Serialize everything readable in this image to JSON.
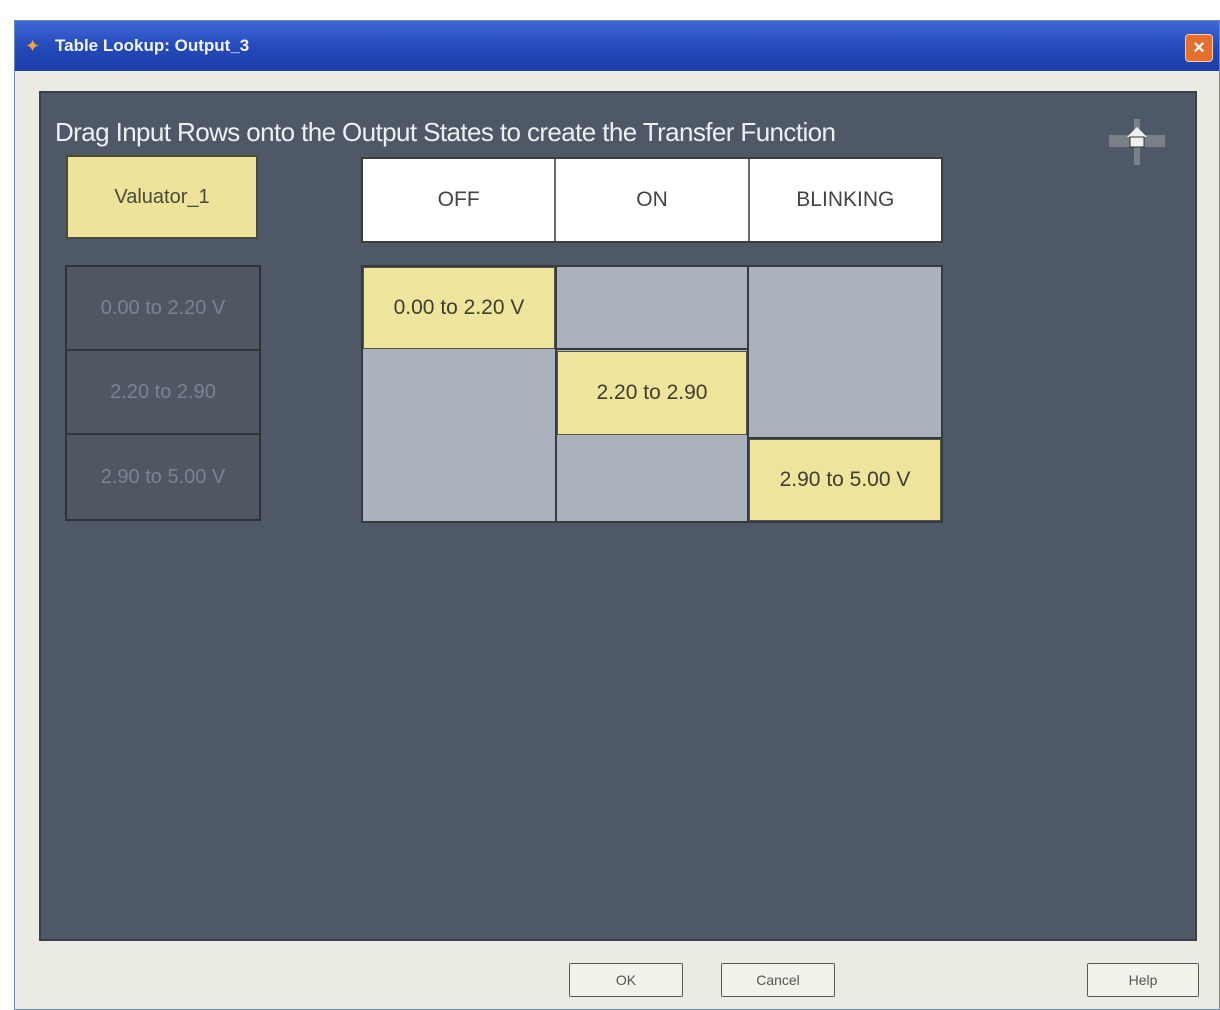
{
  "window": {
    "title": "Table Lookup: Output_3",
    "close_label": "×"
  },
  "instruction": "Drag Input Rows onto the Output States to create the Transfer Function",
  "input": {
    "header": "Valuator_1",
    "rows": [
      "0.00 to 2.20 V",
      "2.20 to 2.90",
      "2.90 to 5.00 V"
    ]
  },
  "outputs": {
    "states": [
      "OFF",
      "ON",
      "BLINKING"
    ]
  },
  "mapping": [
    {
      "label": "0.00 to 2.20 V",
      "state": "OFF"
    },
    {
      "label": "2.20 to 2.90",
      "state": "ON"
    },
    {
      "label": "2.90 to 5.00 V",
      "state": "BLINKING"
    }
  ],
  "buttons": {
    "ok": "OK",
    "cancel": "Cancel",
    "help": "Help"
  },
  "colors": {
    "canvas": "#4e5866",
    "input_header": "#ede39a",
    "assigned_cell": "#efe49c",
    "empty_grid": "#aab1bc",
    "title_bar": "#2348b8"
  }
}
